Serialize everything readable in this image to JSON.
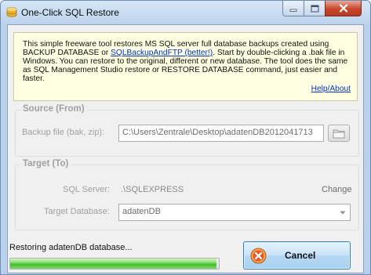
{
  "window": {
    "title": "One-Click SQL Restore"
  },
  "info": {
    "text_part1": "This simple freeware tool restores MS SQL server full database backups created using BACKUP DATABASE or ",
    "link_text": "SQLBackupAndFTP (better!)",
    "text_part2": ". Start by double-clicking a .bak file in Windows. You can restore to the original, different or new database. The tool does the same as SQL Management Studio restore or RESTORE DATABASE command, just easier and faster.",
    "help_link": "Help/About"
  },
  "source": {
    "legend": "Source (From)",
    "backup_label": "Backup file (bak, zip):",
    "backup_value": "C:\\Users\\Zentrale\\Desktop\\adatenDB2012041713"
  },
  "target": {
    "legend": "Target (To)",
    "server_label": "SQL Server:",
    "server_value": ".\\SQLEXPRESS",
    "change_label": "Change",
    "database_label": "Target Database:",
    "database_value": "adatenDB"
  },
  "status": {
    "text": "Restoring adatenDB database...",
    "progress": 0.99
  },
  "actions": {
    "cancel_label": "Cancel"
  },
  "colors": {
    "accent": "#3c7fb1",
    "progress_green": "#3ebc2a",
    "close_red": "#c9452c",
    "info_background": "#ffffe1"
  }
}
